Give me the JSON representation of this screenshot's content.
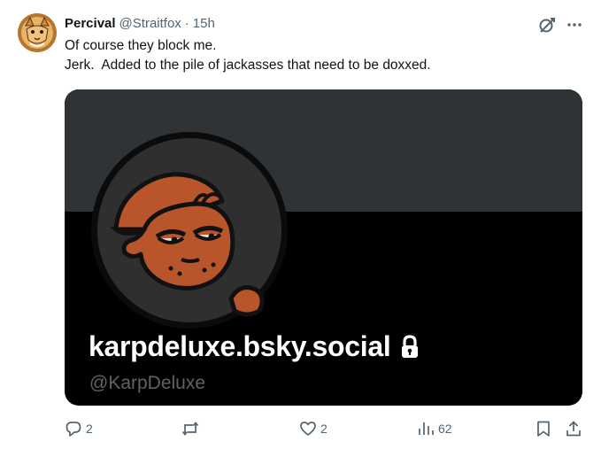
{
  "author": {
    "name": "Percival",
    "handle": "@Straitfox",
    "separator": "·",
    "time": "15h",
    "avatar_icon": "fox-avatar"
  },
  "tweet": {
    "text": "Of course they block me.\nJerk.  Added to the pile of jackasses that need to be doxxed."
  },
  "card": {
    "title": "karpdeluxe.bsky.social",
    "handle": "@KarpDeluxe",
    "avatar_icon": "cartoon-face-avatar",
    "lock_icon": "lock-icon",
    "banner_color": "#303336",
    "background_color": "#000000"
  },
  "actions": {
    "replies": "2",
    "reposts": "",
    "likes": "2",
    "views": "62"
  },
  "colors": {
    "text_primary": "#0f1419",
    "text_secondary": "#536471",
    "card_handle": "#5f6368"
  }
}
